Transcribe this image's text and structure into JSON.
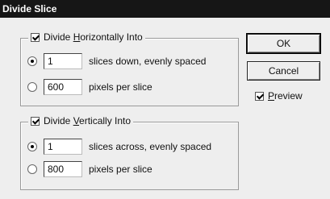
{
  "dialog": {
    "title": "Divide Slice"
  },
  "horizontal": {
    "label_before": "Divide ",
    "label_mnemonic": "H",
    "label_after": "orizontally Into",
    "checked": true,
    "slices_value": "1",
    "slices_label": "slices down, evenly spaced",
    "pixels_value": "600",
    "pixels_label": "pixels per slice",
    "selected_option": "slices"
  },
  "vertical": {
    "label_before": "Divide ",
    "label_mnemonic": "V",
    "label_after": "ertically Into",
    "checked": true,
    "slices_value": "1",
    "slices_label": "slices across, evenly spaced",
    "pixels_value": "800",
    "pixels_label": "pixels per slice",
    "selected_option": "slices"
  },
  "buttons": {
    "ok": "OK",
    "cancel": "Cancel"
  },
  "preview": {
    "mnemonic": "P",
    "label_rest": "review",
    "checked": true
  }
}
